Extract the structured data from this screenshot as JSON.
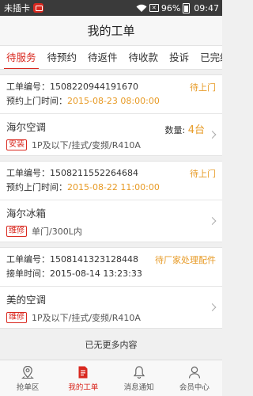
{
  "status_bar": {
    "carrier": "未插卡",
    "battery": "96%",
    "time": "09:47"
  },
  "header": {
    "title": "我的工单"
  },
  "tabs": [
    {
      "label": "待服务",
      "active": true
    },
    {
      "label": "待预约",
      "active": false
    },
    {
      "label": "待返件",
      "active": false
    },
    {
      "label": "待收款",
      "active": false
    },
    {
      "label": "投诉",
      "active": false
    },
    {
      "label": "已完结",
      "active": false
    }
  ],
  "orders": [
    {
      "order_label": "工单编号：",
      "order_no": "1508220944191670",
      "time_label": "预约上门时间：",
      "time_value": "2015-08-23 08:00:00",
      "time_highlight": true,
      "status": "待上门",
      "product": "海尔空调",
      "quantity_label": "数量: ",
      "quantity": "4台",
      "tag": "安装",
      "spec": "1P及以下/挂式/变频/R410A"
    },
    {
      "order_label": "工单编号：",
      "order_no": "1508211552264684",
      "time_label": "预约上门时间：",
      "time_value": "2015-08-22 11:00:00",
      "time_highlight": true,
      "status": "待上门",
      "product": "海尔冰箱",
      "quantity_label": "",
      "quantity": "",
      "tag": "维修",
      "spec": "单门/300L内"
    },
    {
      "order_label": "工单编号：",
      "order_no": "1508141323128448",
      "time_label": "接单时间：",
      "time_value": "2015-08-14 13:23:33",
      "time_highlight": false,
      "status": "待厂家处理配件",
      "product": "美的空调",
      "quantity_label": "",
      "quantity": "",
      "tag": "维修",
      "spec": "1P及以下/挂式/变频/R410A"
    }
  ],
  "list_end_text": "已无更多内容",
  "bottom_nav": [
    {
      "label": "抢单区",
      "icon": "location-pin-icon",
      "active": false
    },
    {
      "label": "我的工单",
      "icon": "document-icon",
      "active": true
    },
    {
      "label": "消息通知",
      "icon": "bell-icon",
      "active": false
    },
    {
      "label": "会员中心",
      "icon": "user-icon",
      "active": false
    }
  ],
  "colors": {
    "accent": "#d9281f",
    "highlight": "#e79a25"
  }
}
